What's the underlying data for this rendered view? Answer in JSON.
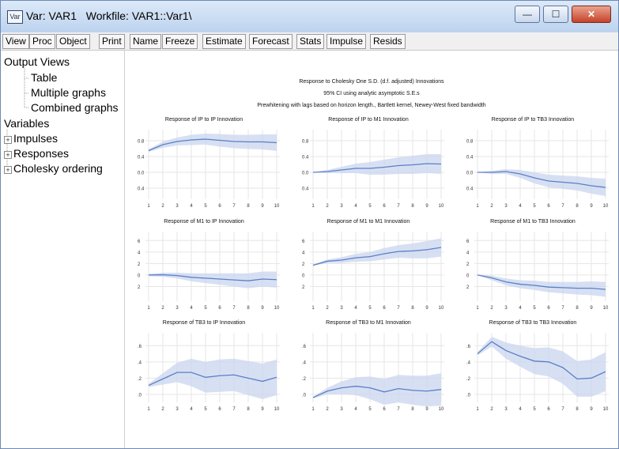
{
  "window": {
    "title": "Var: VAR1   Workfile: VAR1::Var1\\",
    "icon_text": "Var",
    "minimize_glyph": "—",
    "maximize_glyph": "☐",
    "close_glyph": "✕"
  },
  "toolbar": {
    "buttons": [
      "View",
      "Proc",
      "Object",
      "Print",
      "Name",
      "Freeze",
      "Estimate",
      "Forecast",
      "Stats",
      "Impulse",
      "Resids"
    ]
  },
  "tree": {
    "output_views": "Output Views",
    "table": "Table",
    "multiple_graphs": "Multiple graphs",
    "combined_graphs": "Combined graphs",
    "variables": "Variables",
    "impulses": "Impulses",
    "responses": "Responses",
    "cholesky": "Cholesky ordering"
  },
  "graph": {
    "header_line1": "Response to Cholesky One S.D. (d.f. adjusted) Innovations",
    "header_line2": "95% CI using analytic asymptotic S.E.s",
    "header_line3": "Prewhitening with lags based on horizon length., Bartlett kernel, Newey-West fixed bandwidth",
    "line_color": "#5b7fc7",
    "band_color": "#c9d6ef"
  },
  "chart_data": [
    {
      "type": "line",
      "title": "Response of IP to IP Innovation",
      "x": [
        1,
        2,
        3,
        4,
        5,
        6,
        7,
        8,
        9,
        10
      ],
      "values": [
        0.55,
        0.7,
        0.78,
        0.82,
        0.84,
        0.81,
        0.78,
        0.77,
        0.77,
        0.75
      ],
      "upper": [
        0.58,
        0.78,
        0.88,
        0.95,
        0.98,
        0.97,
        0.95,
        0.95,
        0.96,
        0.96
      ],
      "lower": [
        0.52,
        0.62,
        0.68,
        0.69,
        0.7,
        0.65,
        0.61,
        0.59,
        0.58,
        0.54
      ],
      "ylim": [
        -0.6,
        1.0
      ],
      "yticks": [
        0.8,
        0.4,
        0.0,
        -0.4
      ],
      "yticklabels": [
        "0.8",
        "0.4",
        "0.0",
        "0.4"
      ]
    },
    {
      "type": "line",
      "title": "Response of IP to M1 Innovation",
      "x": [
        1,
        2,
        3,
        4,
        5,
        6,
        7,
        8,
        9,
        10
      ],
      "values": [
        0.0,
        0.02,
        0.06,
        0.1,
        0.1,
        0.13,
        0.17,
        0.19,
        0.22,
        0.21
      ],
      "upper": [
        0.0,
        0.06,
        0.14,
        0.22,
        0.26,
        0.32,
        0.38,
        0.42,
        0.46,
        0.46
      ],
      "lower": [
        0.0,
        -0.02,
        -0.02,
        -0.02,
        -0.06,
        -0.06,
        -0.04,
        -0.04,
        -0.02,
        -0.04
      ],
      "ylim": [
        -0.6,
        1.0
      ],
      "yticks": [
        0.8,
        0.4,
        0.0,
        -0.4
      ],
      "yticklabels": [
        "0.8",
        "0.4",
        "0.0",
        "0.4"
      ]
    },
    {
      "type": "line",
      "title": "Response of IP to TB3 Innovation",
      "x": [
        1,
        2,
        3,
        4,
        5,
        6,
        7,
        8,
        9,
        10
      ],
      "values": [
        0.0,
        0.0,
        0.02,
        -0.04,
        -0.14,
        -0.22,
        -0.25,
        -0.28,
        -0.34,
        -0.38
      ],
      "upper": [
        0.0,
        0.04,
        0.08,
        0.06,
        0.0,
        -0.06,
        -0.08,
        -0.1,
        -0.14,
        -0.16
      ],
      "lower": [
        0.0,
        -0.04,
        -0.04,
        -0.14,
        -0.28,
        -0.38,
        -0.42,
        -0.46,
        -0.54,
        -0.6
      ],
      "ylim": [
        -0.6,
        1.0
      ],
      "yticks": [
        0.8,
        0.4,
        0.0,
        -0.4
      ],
      "yticklabels": [
        "0.8",
        "0.4",
        "0.0",
        "0.4"
      ]
    },
    {
      "type": "line",
      "title": "Response of M1 to IP Innovation",
      "x": [
        1,
        2,
        3,
        4,
        5,
        6,
        7,
        8,
        9,
        10
      ],
      "values": [
        0.0,
        0.05,
        -0.1,
        -0.4,
        -0.55,
        -0.7,
        -0.85,
        -1.0,
        -0.7,
        -0.8
      ],
      "upper": [
        0.2,
        0.4,
        0.4,
        0.3,
        0.3,
        0.3,
        0.3,
        0.3,
        0.6,
        0.6
      ],
      "lower": [
        -0.2,
        -0.3,
        -0.6,
        -1.1,
        -1.4,
        -1.7,
        -2.0,
        -2.3,
        -2.0,
        -2.2
      ],
      "ylim": [
        -4,
        7
      ],
      "yticks": [
        6,
        4,
        2,
        0,
        -2
      ],
      "yticklabels": [
        "6",
        "4",
        "2",
        "0",
        "2"
      ]
    },
    {
      "type": "line",
      "title": "Response of M1 to M1 Innovation",
      "x": [
        1,
        2,
        3,
        4,
        5,
        6,
        7,
        8,
        9,
        10
      ],
      "values": [
        1.7,
        2.4,
        2.6,
        3.0,
        3.2,
        3.7,
        4.1,
        4.2,
        4.4,
        4.8
      ],
      "upper": [
        1.8,
        2.7,
        3.1,
        3.7,
        4.0,
        4.7,
        5.2,
        5.5,
        5.9,
        6.4
      ],
      "lower": [
        1.6,
        2.1,
        2.1,
        2.3,
        2.4,
        2.7,
        3.0,
        2.9,
        2.9,
        3.2
      ],
      "ylim": [
        -4,
        7
      ],
      "yticks": [
        6,
        4,
        2,
        0,
        -2
      ],
      "yticklabels": [
        "6",
        "4",
        "2",
        "0",
        "2"
      ]
    },
    {
      "type": "line",
      "title": "Response of M1 to TB3 Innovation",
      "x": [
        1,
        2,
        3,
        4,
        5,
        6,
        7,
        8,
        9,
        10
      ],
      "values": [
        0.0,
        -0.5,
        -1.2,
        -1.6,
        -1.8,
        -2.1,
        -2.2,
        -2.3,
        -2.3,
        -2.5
      ],
      "upper": [
        0.0,
        -0.1,
        -0.6,
        -0.9,
        -1.0,
        -1.2,
        -1.2,
        -1.2,
        -1.1,
        -1.2
      ],
      "lower": [
        0.0,
        -0.9,
        -1.8,
        -2.3,
        -2.6,
        -3.0,
        -3.2,
        -3.4,
        -3.5,
        -3.8
      ],
      "ylim": [
        -4,
        7
      ],
      "yticks": [
        6,
        4,
        2,
        0,
        -2
      ],
      "yticklabels": [
        "6",
        "4",
        "2",
        "0",
        "2"
      ]
    },
    {
      "type": "line",
      "title": "Response of TB3 to IP Innovation",
      "x": [
        1,
        2,
        3,
        4,
        5,
        6,
        7,
        8,
        9,
        10
      ],
      "values": [
        0.11,
        0.19,
        0.27,
        0.27,
        0.21,
        0.23,
        0.24,
        0.2,
        0.16,
        0.21
      ],
      "upper": [
        0.13,
        0.26,
        0.39,
        0.44,
        0.4,
        0.43,
        0.44,
        0.41,
        0.38,
        0.43
      ],
      "lower": [
        0.09,
        0.12,
        0.15,
        0.1,
        0.02,
        0.03,
        0.04,
        -0.01,
        -0.06,
        -0.01
      ],
      "ylim": [
        -0.06,
        0.72
      ],
      "yticks": [
        0.6,
        0.4,
        0.2,
        0.0
      ],
      "yticklabels": [
        ".6",
        ".4",
        ".2",
        ".0"
      ]
    },
    {
      "type": "line",
      "title": "Response of TB3 to M1 Innovation",
      "x": [
        1,
        2,
        3,
        4,
        5,
        6,
        7,
        8,
        9,
        10
      ],
      "values": [
        -0.04,
        0.04,
        0.08,
        0.1,
        0.08,
        0.03,
        0.07,
        0.05,
        0.04,
        0.06
      ],
      "upper": [
        -0.03,
        0.08,
        0.16,
        0.21,
        0.22,
        0.19,
        0.24,
        0.23,
        0.23,
        0.26
      ],
      "lower": [
        -0.05,
        0.0,
        0.0,
        -0.01,
        -0.06,
        -0.13,
        -0.1,
        -0.13,
        -0.15,
        -0.14
      ],
      "ylim": [
        -0.06,
        0.72
      ],
      "yticks": [
        0.6,
        0.4,
        0.2,
        0.0
      ],
      "yticklabels": [
        ".6",
        ".4",
        ".2",
        ".0"
      ]
    },
    {
      "type": "line",
      "title": "Response of TB3 to TB3 Innovation",
      "x": [
        1,
        2,
        3,
        4,
        5,
        6,
        7,
        8,
        9,
        10
      ],
      "values": [
        0.5,
        0.65,
        0.54,
        0.47,
        0.41,
        0.4,
        0.33,
        0.19,
        0.2,
        0.28
      ],
      "upper": [
        0.52,
        0.71,
        0.64,
        0.6,
        0.57,
        0.58,
        0.53,
        0.41,
        0.43,
        0.52
      ],
      "lower": [
        0.48,
        0.59,
        0.44,
        0.34,
        0.25,
        0.22,
        0.13,
        -0.03,
        -0.03,
        0.04
      ],
      "ylim": [
        -0.06,
        0.72
      ],
      "yticks": [
        0.6,
        0.4,
        0.2,
        0.0
      ],
      "yticklabels": [
        ".6",
        ".4",
        ".2",
        ".0"
      ]
    }
  ]
}
